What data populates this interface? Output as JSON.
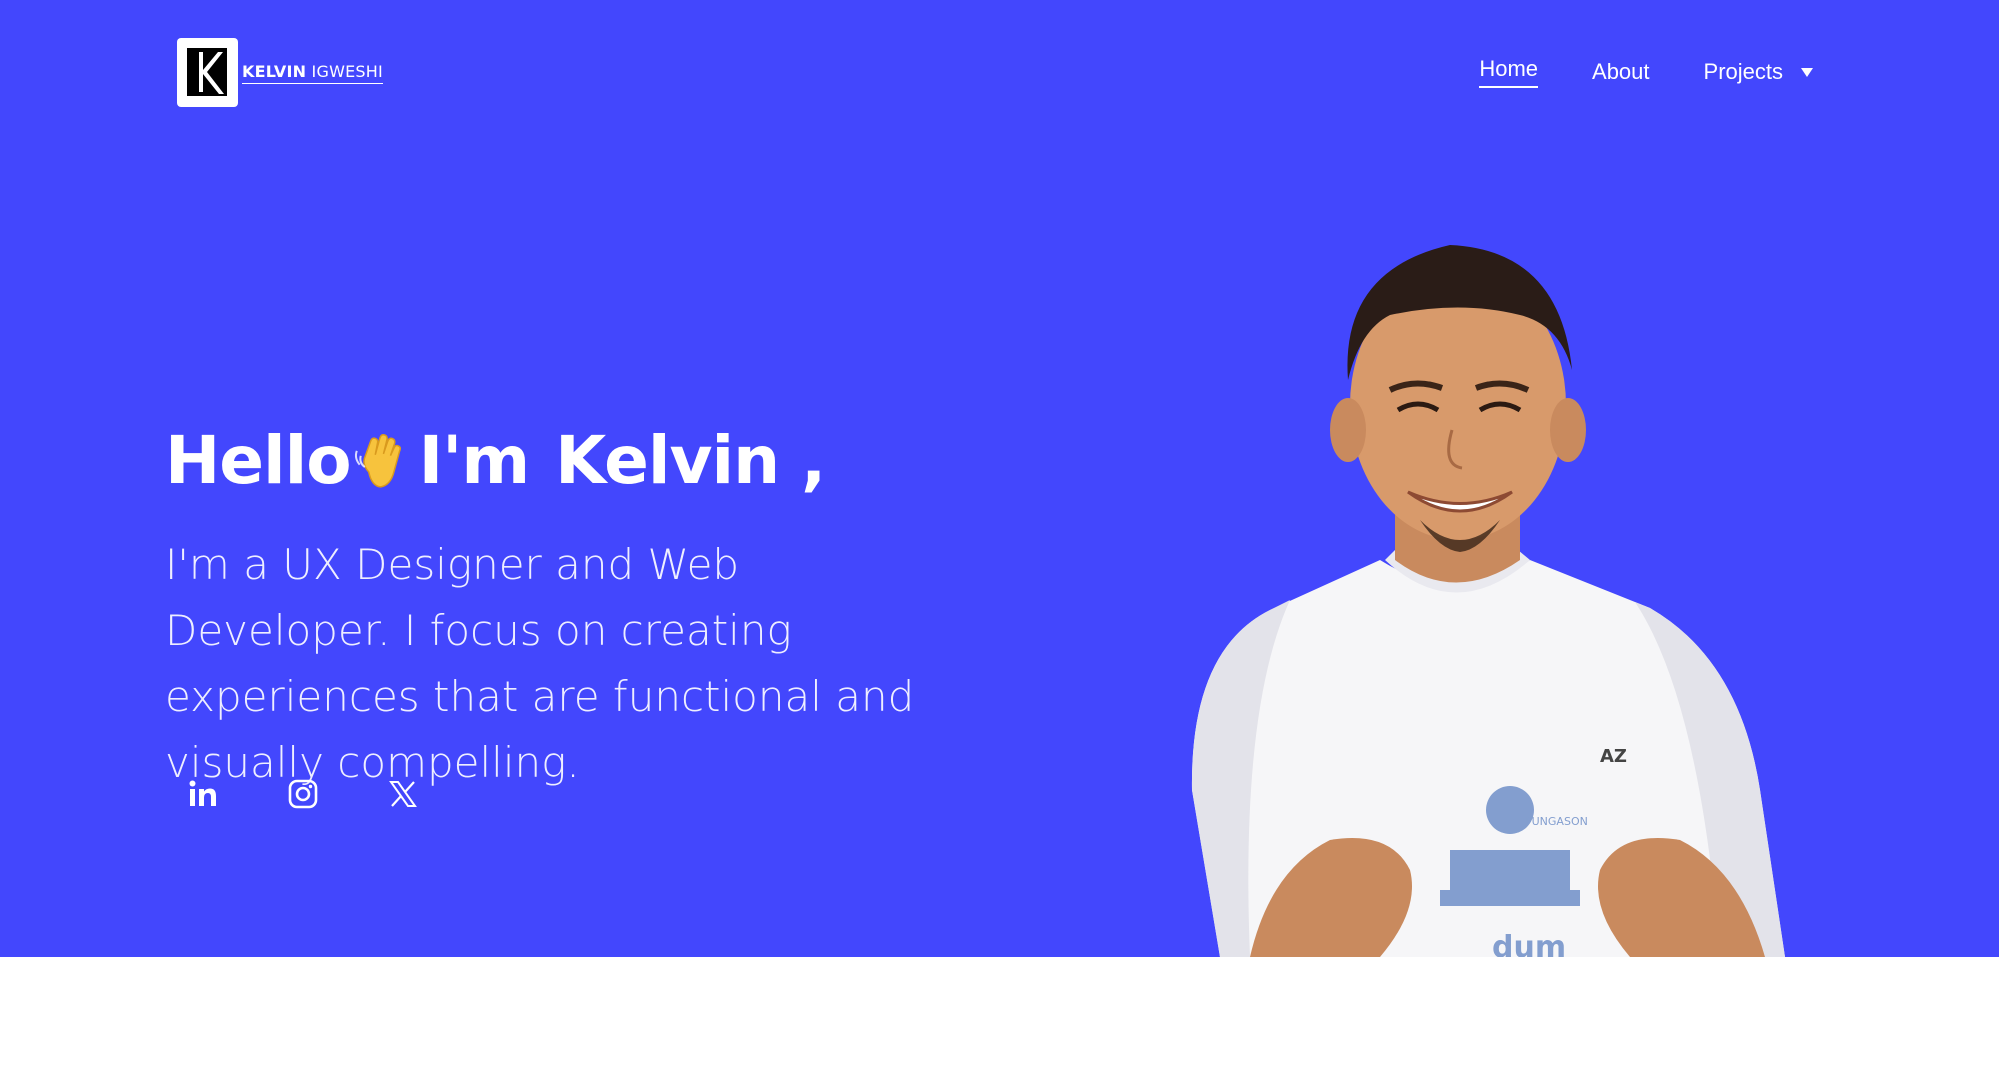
{
  "header": {
    "logo_first": "KELVIN",
    "logo_last": "IGWESHI",
    "logo_icon": "k-monogram-logo"
  },
  "nav": {
    "items": [
      {
        "label": "Home",
        "active": true
      },
      {
        "label": "About",
        "active": false
      },
      {
        "label": "Projects",
        "active": false,
        "has_dropdown": true
      }
    ]
  },
  "hero": {
    "hello": "Hello",
    "wave_icon": "waving-hand-icon",
    "im": "I'm",
    "name": "Kelvin ,",
    "intro": "I'm a UX Designer and Web Developer. I focus on creating experiences that are functional and visually compelling.",
    "portrait_icon": "portrait-illustration",
    "shirt_text": "dum"
  },
  "social": [
    {
      "name": "linkedin-icon"
    },
    {
      "name": "instagram-icon"
    },
    {
      "name": "x-twitter-icon"
    }
  ],
  "colors": {
    "hero_bg": "#4347fd",
    "text": "#ffffff"
  }
}
